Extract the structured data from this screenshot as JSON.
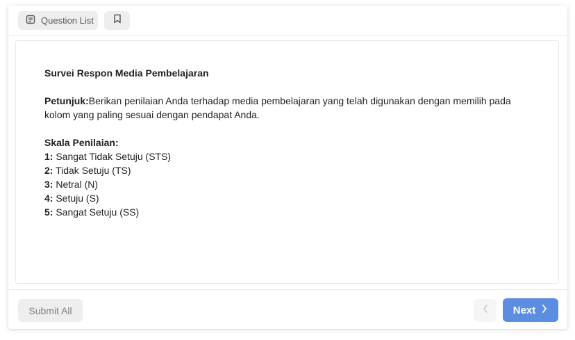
{
  "topbar": {
    "question_list_label": "Question List",
    "question_list_icon": "document-list-icon",
    "bookmark_icon": "bookmark-icon"
  },
  "survey": {
    "title": "Survei Respon Media Pembelajaran",
    "instruction_label": "Petunjuk:",
    "instruction_text": "Berikan penilaian Anda terhadap media pembelajaran yang telah digunakan dengan memilih  pada kolom yang paling sesuai dengan pendapat Anda.",
    "scale_heading": "Skala Penilaian:",
    "scale": [
      {
        "num": "1:",
        "label": "Sangat Tidak Setuju (STS)"
      },
      {
        "num": "2:",
        "label": "Tidak Setuju (TS)"
      },
      {
        "num": "3:",
        "label": "Netral (N)"
      },
      {
        "num": "4:",
        "label": "Setuju (S)"
      },
      {
        "num": "5:",
        "label": "Sangat Setuju (SS)"
      }
    ]
  },
  "footer": {
    "submit_label": "Submit All",
    "next_label": "Next",
    "prev_icon": "chevron-left-icon",
    "next_icon": "chevron-right-icon"
  },
  "colors": {
    "accent": "#5b8de0",
    "button_gray": "#eeeeef"
  }
}
